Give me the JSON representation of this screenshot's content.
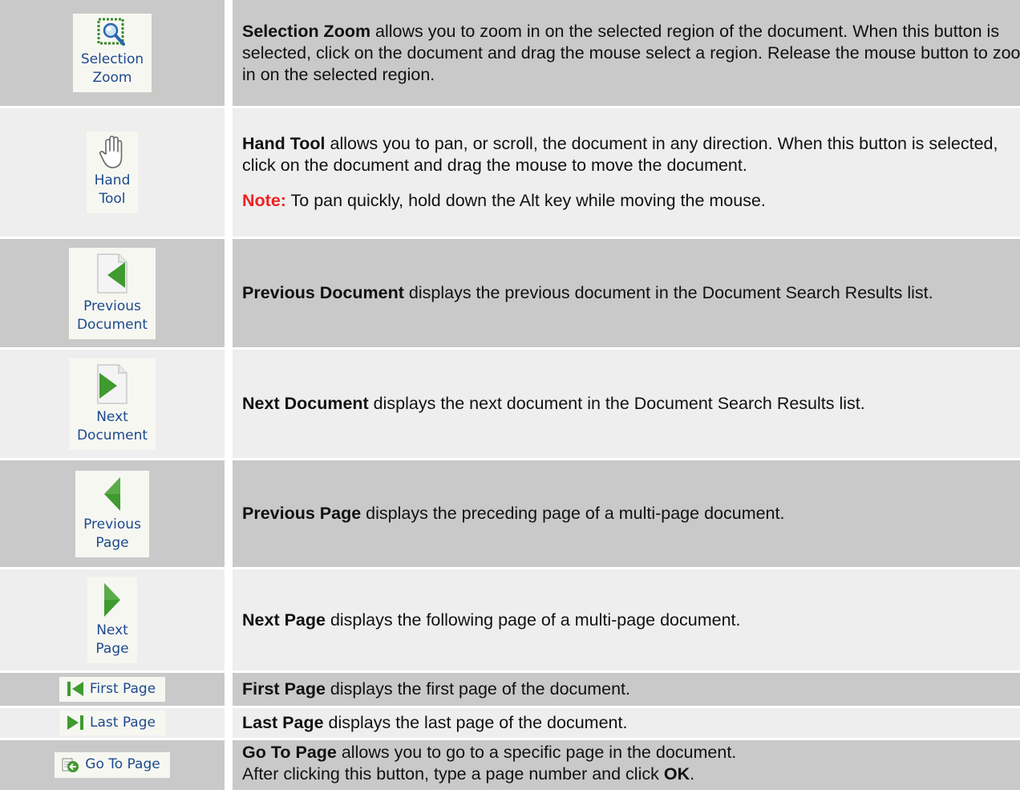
{
  "rows": [
    {
      "button_label_line1": "Selection",
      "button_label_line2": "Zoom",
      "icon": "selection-zoom-icon",
      "title": "Selection Zoom",
      "description": " allows you to zoom in on the selected region of the document. When this button is selected, click on the document and drag the mouse select a region. Release the mouse button to zoom in on the selected region."
    },
    {
      "button_label_line1": "Hand",
      "button_label_line2": "Tool",
      "icon": "hand-icon",
      "title": "Hand Tool",
      "description": " allows you to pan, or scroll, the document in any direction. When this button is selected, click on the document and drag the mouse to move the document.",
      "note_label": "Note:",
      "note_text": " To pan quickly, hold down the Alt key while moving the mouse."
    },
    {
      "button_label_line1": "Previous",
      "button_label_line2": "Document",
      "icon": "previous-document-icon",
      "title": "Previous Document",
      "description": " displays the previous document in the Document Search Results list."
    },
    {
      "button_label_line1": "Next",
      "button_label_line2": "Document",
      "icon": "next-document-icon",
      "title": "Next Document",
      "description": " displays the next document in the Document Search Results list."
    },
    {
      "button_label_line1": "Previous",
      "button_label_line2": "Page",
      "icon": "previous-page-icon",
      "title": "Previous Page",
      "description": " displays the preceding page of a multi-page document."
    },
    {
      "button_label_line1": "Next",
      "button_label_line2": "Page",
      "icon": "next-page-icon",
      "title": "Next Page",
      "description": " displays the following page of a multi-page document."
    },
    {
      "button_label": "First Page",
      "icon": "first-page-icon",
      "title": "First Page",
      "description": " displays the first page of the document."
    },
    {
      "button_label": "Last Page",
      "icon": "last-page-icon",
      "title": "Last Page",
      "description": " displays the last page of the document."
    },
    {
      "button_label": "Go To Page",
      "icon": "go-to-page-icon",
      "title": "Go To Page",
      "description": " allows you to go to a specific page in the document.",
      "line2_text": "After clicking this button, type a page number and click ",
      "line2_bold": "OK",
      "line2_end": "."
    }
  ],
  "colors": {
    "row_dark": "#c9c9c9",
    "row_light": "#eeeeee",
    "button_label": "#1d4a8e",
    "note_label": "#ee2222",
    "arrow_green": "#3f9a2f"
  }
}
